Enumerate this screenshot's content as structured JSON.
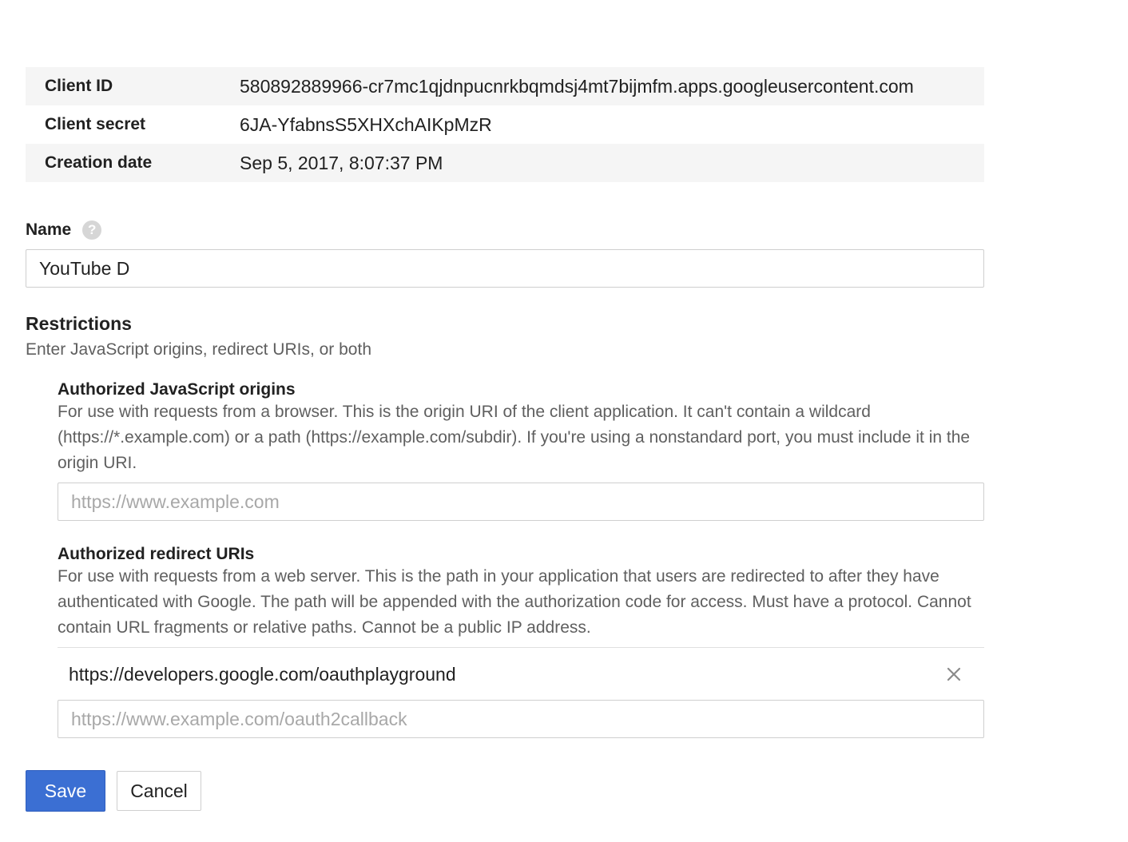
{
  "client_info": {
    "rows": [
      {
        "label": "Client ID",
        "value": "580892889966-cr7mc1qjdnpucnrkbqmdsj4mt7bijmfm.apps.googleusercontent.com"
      },
      {
        "label": "Client secret",
        "value": "6JA-YfabnsS5XHXchAIKpMzR"
      },
      {
        "label": "Creation date",
        "value": "Sep 5, 2017, 8:07:37 PM"
      }
    ]
  },
  "name_field": {
    "label": "Name",
    "help_icon": "help-icon",
    "value": "YouTube D"
  },
  "restrictions": {
    "title": "Restrictions",
    "subtitle": "Enter JavaScript origins, redirect URIs, or both",
    "js_origins": {
      "title": "Authorized JavaScript origins",
      "description": "For use with requests from a browser. This is the origin URI of the client application. It can't contain a wildcard (https://*.example.com) or a path (https://example.com/subdir). If you're using a nonstandard port, you must include it in the origin URI.",
      "placeholder": "https://www.example.com"
    },
    "redirect_uris": {
      "title": "Authorized redirect URIs",
      "description": "For use with requests from a web server. This is the path in your application that users are redirected to after they have authenticated with Google. The path will be appended with the authorization code for access. Must have a protocol. Cannot contain URL fragments or relative paths. Cannot be a public IP address.",
      "entries": [
        "https://developers.google.com/oauthplayground"
      ],
      "placeholder": "https://www.example.com/oauth2callback"
    }
  },
  "actions": {
    "save_label": "Save",
    "cancel_label": "Cancel"
  },
  "colors": {
    "primary": "#3b6fd3",
    "row_shade": "#f5f5f5"
  }
}
